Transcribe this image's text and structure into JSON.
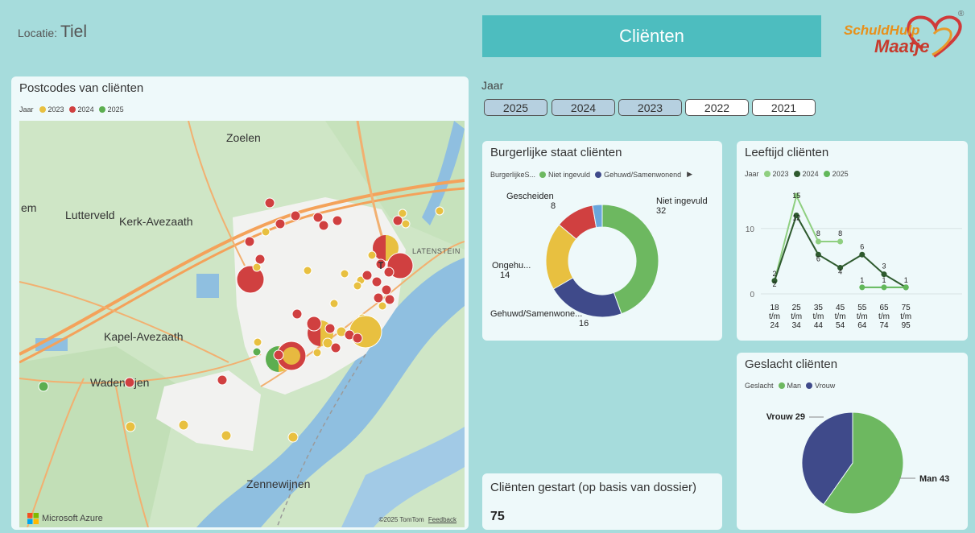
{
  "header": {
    "locatie_label": "Locatie:",
    "locatie_value": "Tiel",
    "page_title": "Cliënten",
    "logo_line1": "SchuldHulp",
    "logo_line2": "Maatje",
    "logo_reg": "®"
  },
  "map": {
    "title": "Postcodes van cliënten",
    "legend_label": "Jaar",
    "legend": [
      {
        "label": "2023",
        "color": "#e8c040"
      },
      {
        "label": "2024",
        "color": "#d04040"
      },
      {
        "label": "2025",
        "color": "#5cae50"
      }
    ],
    "places": [
      "Zoelen",
      "em",
      "Lutterveld",
      "Kerk-Avezaath",
      "LATENSTEIN",
      "Kapel-Avezaath",
      "Wadenoijen",
      "Zennewijnen"
    ],
    "attribution_left": "Microsoft Azure",
    "attribution_right": "©2025 TomTom",
    "feedback": "Feedback"
  },
  "year_filter": {
    "label": "Jaar",
    "years": [
      {
        "label": "2025",
        "selected": true
      },
      {
        "label": "2024",
        "selected": true
      },
      {
        "label": "2023",
        "selected": true
      },
      {
        "label": "2022",
        "selected": false
      },
      {
        "label": "2021",
        "selected": false
      }
    ]
  },
  "burgerlijke_staat": {
    "title": "Burgerlijke staat cliënten",
    "legend_label": "BurgerlijkeS...",
    "legend": [
      {
        "label": "Niet ingevuld",
        "color": "#6db860"
      },
      {
        "label": "Gehuwd/Samenwonend",
        "color": "#3f4a8a"
      }
    ],
    "legend_more": "▶",
    "chart_data": {
      "type": "pie",
      "donut": true,
      "slices": [
        {
          "label": "Niet ingevuld",
          "value": 32,
          "color": "#6db860"
        },
        {
          "label": "Gehuwd/Samenwone...",
          "value": 16,
          "color": "#3f4a8a"
        },
        {
          "label": "Ongehu...",
          "value": 14,
          "color": "#e8c040"
        },
        {
          "label": "Gescheiden",
          "value": 8,
          "color": "#d04040"
        },
        {
          "label": "",
          "value": 2,
          "color": "#6aa6dc"
        }
      ]
    }
  },
  "leeftijd": {
    "title": "Leeftijd cliënten",
    "legend_label": "Jaar",
    "legend": [
      {
        "label": "2023",
        "color": "#8fcf80"
      },
      {
        "label": "2024",
        "color": "#2e5a2e"
      },
      {
        "label": "2025",
        "color": "#62b85a"
      }
    ],
    "chart_data": {
      "type": "line",
      "categories": [
        [
          "18",
          "t/m",
          "24"
        ],
        [
          "25",
          "t/m",
          "34"
        ],
        [
          "35",
          "t/m",
          "44"
        ],
        [
          "45",
          "t/m",
          "54"
        ],
        [
          "55",
          "t/m",
          "64"
        ],
        [
          "65",
          "t/m",
          "74"
        ],
        [
          "75",
          "t/m",
          "95"
        ]
      ],
      "yticks": [
        0,
        10
      ],
      "ylim": [
        0,
        16
      ],
      "series": [
        {
          "name": "2023",
          "color": "#8fcf80",
          "values": [
            2,
            15,
            8,
            8,
            null,
            null,
            null
          ]
        },
        {
          "name": "2024",
          "color": "#2e5a2e",
          "values": [
            2,
            12,
            6,
            4,
            6,
            3,
            1
          ]
        },
        {
          "name": "2025",
          "color": "#62b85a",
          "values": [
            null,
            null,
            null,
            null,
            1,
            1,
            1
          ]
        }
      ],
      "labels": [
        {
          "text": "2",
          "cat": 0,
          "value": 2,
          "dy": -6
        },
        {
          "text": "2",
          "cat": 0,
          "value": 2,
          "dy": 7
        },
        {
          "text": "15",
          "cat": 1,
          "value": 15,
          "dy": 3
        },
        {
          "text": "12",
          "cat": 1,
          "value": 12,
          "dy": 6
        },
        {
          "text": "8",
          "cat": 2,
          "value": 8,
          "dy": -7
        },
        {
          "text": "6",
          "cat": 2,
          "value": 6,
          "dy": 8
        },
        {
          "text": "8",
          "cat": 3,
          "value": 8,
          "dy": -7
        },
        {
          "text": "4",
          "cat": 3,
          "value": 4,
          "dy": 8
        },
        {
          "text": "6",
          "cat": 4,
          "value": 6,
          "dy": -7
        },
        {
          "text": "1",
          "cat": 4,
          "value": 1,
          "dy": -6
        },
        {
          "text": "3",
          "cat": 5,
          "value": 3,
          "dy": -7
        },
        {
          "text": "1",
          "cat": 5,
          "value": 1,
          "dy": -6
        },
        {
          "text": "1",
          "cat": 6,
          "value": 1,
          "dy": -6
        }
      ]
    }
  },
  "geslacht": {
    "title": "Geslacht cliënten",
    "legend_label": "Geslacht",
    "legend": [
      {
        "label": "Man",
        "color": "#6db860"
      },
      {
        "label": "Vrouw",
        "color": "#3f4a8a"
      }
    ],
    "chart_data": {
      "type": "pie",
      "slices": [
        {
          "label": "Man",
          "value": 43,
          "color": "#6db860",
          "display": "Man 43"
        },
        {
          "label": "Vrouw",
          "value": 29,
          "color": "#3f4a8a",
          "display": "Vrouw 29"
        }
      ]
    }
  },
  "gestart": {
    "title": "Cliënten gestart (op basis van dossier)",
    "value": "75"
  }
}
